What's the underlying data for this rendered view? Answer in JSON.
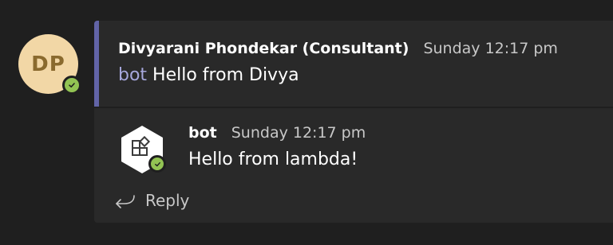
{
  "root_message": {
    "author_initials": "DP",
    "author_name": "Divyarani Phondekar (Consultant)",
    "timestamp": "Sunday 12:17 pm",
    "mention": "bot",
    "text": " Hello from Divya",
    "presence": "available"
  },
  "reply_message": {
    "author_name": "bot",
    "timestamp": "Sunday 12:17 pm",
    "text": "Hello from lambda!",
    "avatar_icon": "app-grid-icon",
    "presence": "available"
  },
  "reply_action": {
    "label": "Reply",
    "icon": "reply-arrow-icon"
  },
  "colors": {
    "background": "#1f1f1f",
    "card": "#292929",
    "accent": "#6264a7",
    "mention": "#a6a7dc",
    "presence_available": "#92c353",
    "avatar_bg": "#f2d7a6",
    "avatar_text": "#8a6a2e"
  }
}
